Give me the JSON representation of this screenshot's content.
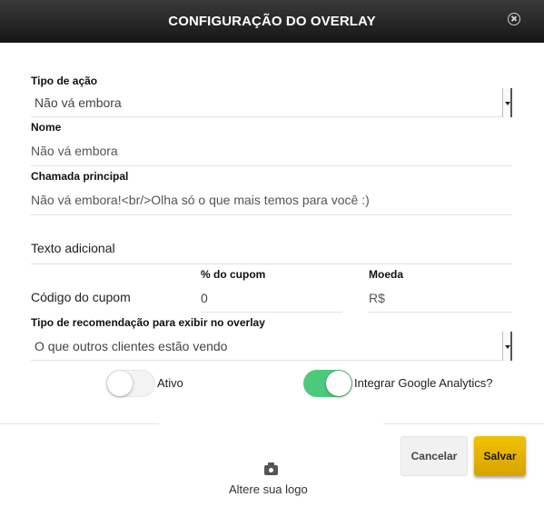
{
  "header": {
    "title": "CONFIGURAÇÃO DO OVERLAY"
  },
  "form": {
    "action_type": {
      "label": "Tipo de ação",
      "value": "Não vá embora"
    },
    "name": {
      "label": "Nome",
      "value": "Não vá embora"
    },
    "headline": {
      "label": "Chamada principal",
      "value": "Não vá embora!<br/>Olha só o que mais temos para você :)"
    },
    "additional_text": {
      "placeholder": "Texto adicional"
    },
    "coupon": {
      "code_label": "Código do cupom",
      "percent_label": "% do cupom",
      "percent_value": "0",
      "currency_label": "Moeda",
      "currency_value": "R$"
    },
    "recommendation": {
      "label": "Tipo de recomendação para exibir no overlay",
      "value": "O que outros clientes estão vendo"
    },
    "active_toggle": {
      "label": "Ativo",
      "on": false
    },
    "analytics_toggle": {
      "label": "Integrar Google Analytics?",
      "on": true
    }
  },
  "footer": {
    "cancel_label": "Cancelar",
    "save_label": "Salvar",
    "logo_label": "Altere sua logo"
  },
  "colors": {
    "accent_green": "#4cca7c",
    "save_yellow": "#e4b400",
    "header_dark": "#1e1e1e"
  }
}
